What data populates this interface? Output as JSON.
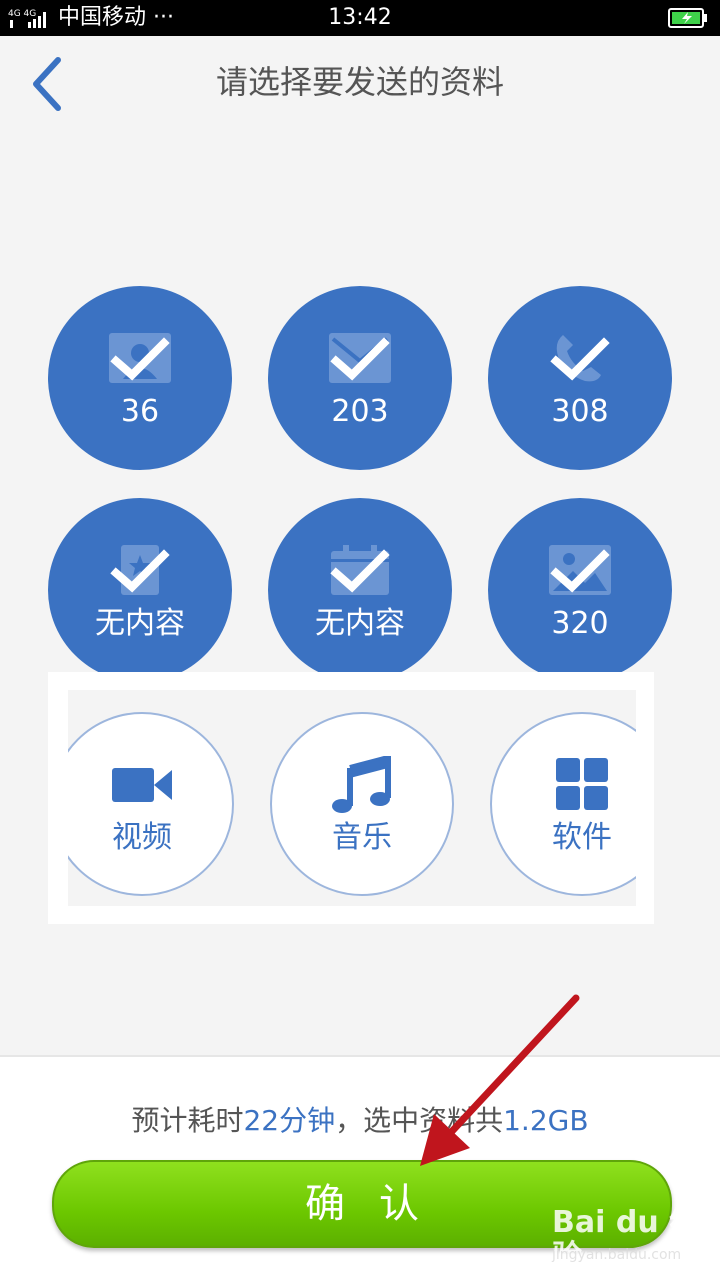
{
  "status_bar": {
    "network": "4G 4G",
    "carrier": "中国移动 ···",
    "time": "13:42"
  },
  "header": {
    "back_icon": "chevron-left-icon",
    "title": "请选择要发送的资料"
  },
  "selected_categories": [
    {
      "icon": "contacts-icon",
      "count": "36"
    },
    {
      "icon": "messages-icon",
      "count": "203"
    },
    {
      "icon": "call-log-icon",
      "count": "308"
    },
    {
      "icon": "bookmark-icon",
      "count": "无内容"
    },
    {
      "icon": "calendar-icon",
      "count": "无内容"
    },
    {
      "icon": "photos-icon",
      "count": "320"
    }
  ],
  "unselected_categories": [
    {
      "icon": "video-icon",
      "label": "视频"
    },
    {
      "icon": "music-icon",
      "label": "音乐"
    },
    {
      "icon": "apps-icon",
      "label": "软件"
    }
  ],
  "footer": {
    "estimate_prefix": "预计耗时",
    "estimate_time": "22分钟",
    "estimate_middle": "，选中资料共",
    "estimate_size": "1.2GB",
    "confirm_label": "确认"
  },
  "watermark": {
    "brand": "Bai du 经验",
    "sub": "jingyan.baidu.com"
  },
  "colors": {
    "accent": "#3b72c2",
    "confirm_green": "#6cc700",
    "annotation_arrow": "#c0151d"
  }
}
